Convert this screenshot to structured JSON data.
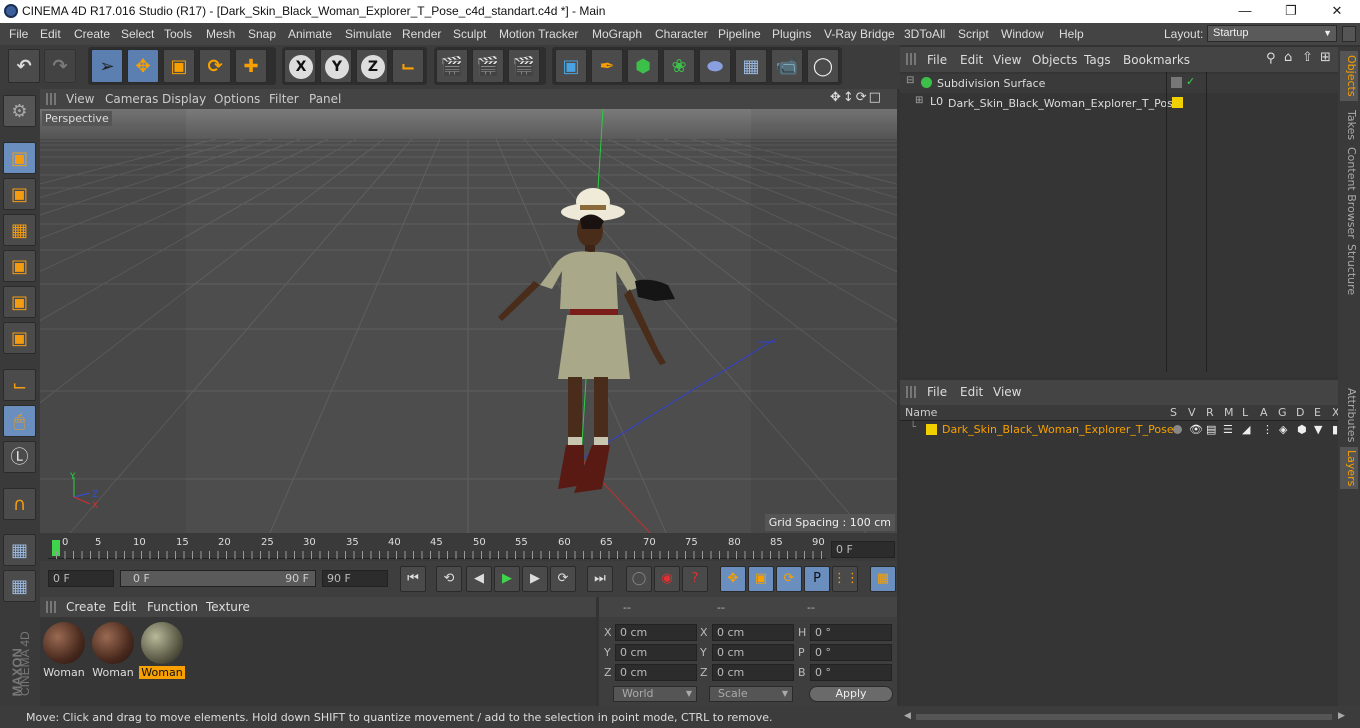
{
  "window": {
    "title": "CINEMA 4D R17.016 Studio (R17) - [Dark_Skin_Black_Woman_Explorer_T_Pose_c4d_standart.c4d *] - Main"
  },
  "menubar": {
    "items": [
      "File",
      "Edit",
      "Create",
      "Select",
      "Tools",
      "Mesh",
      "Snap",
      "Animate",
      "Simulate",
      "Render",
      "Sculpt",
      "Motion Tracker",
      "MoGraph",
      "Character",
      "Pipeline",
      "Plugins",
      "V-Ray Bridge",
      "3DToAll",
      "Script",
      "Window",
      "Help"
    ],
    "layout_label": "Layout:",
    "layout_value": "Startup"
  },
  "viewport": {
    "menu": [
      "View",
      "Cameras",
      "Display",
      "Options",
      "Filter",
      "Panel"
    ],
    "label": "Perspective",
    "grid_spacing": "Grid Spacing : 100 cm"
  },
  "timeline": {
    "ticks": [
      "0",
      "5",
      "10",
      "15",
      "20",
      "25",
      "30",
      "35",
      "40",
      "45",
      "50",
      "55",
      "60",
      "65",
      "70",
      "75",
      "80",
      "85",
      "90"
    ],
    "end_field": "0 F"
  },
  "transport": {
    "start_frame": "0 F",
    "range_start": "0 F",
    "range_end": "90 F",
    "max_frame": "90 F"
  },
  "materials": {
    "menu": [
      "Create",
      "Edit",
      "Function",
      "Texture"
    ],
    "items": [
      {
        "name": "Woman"
      },
      {
        "name": "Woman"
      },
      {
        "name": "Woman",
        "selected": true
      }
    ]
  },
  "coords": {
    "headers": [
      "--",
      "--",
      "--"
    ],
    "rows": [
      {
        "a": "X",
        "av": "0 cm",
        "b": "X",
        "bv": "0 cm",
        "c": "H",
        "cv": "0 °"
      },
      {
        "a": "Y",
        "av": "0 cm",
        "b": "Y",
        "bv": "0 cm",
        "c": "P",
        "cv": "0 °"
      },
      {
        "a": "Z",
        "av": "0 cm",
        "b": "Z",
        "bv": "0 cm",
        "c": "B",
        "cv": "0 °"
      }
    ],
    "space": "World",
    "mode": "Scale",
    "apply": "Apply"
  },
  "objects": {
    "menu": [
      "File",
      "Edit",
      "View",
      "Objects",
      "Tags",
      "Bookmarks"
    ],
    "items": [
      {
        "name": "Subdivision Surface"
      },
      {
        "name": "Dark_Skin_Black_Woman_Explorer_T_Pose"
      }
    ]
  },
  "layers": {
    "menu": [
      "File",
      "Edit",
      "View"
    ],
    "columns": [
      "Name",
      "S",
      "V",
      "R",
      "M",
      "L",
      "A",
      "G",
      "D",
      "E",
      "X"
    ],
    "rows": [
      {
        "name": "Dark_Skin_Black_Woman_Explorer_T_Pose"
      }
    ]
  },
  "side_tabs": [
    "Objects",
    "Takes",
    "Content Browser",
    "Structure",
    "Attributes",
    "Layers"
  ],
  "status": "Move: Click and drag to move elements. Hold down SHIFT to quantize movement / add to the selection in point mode, CTRL to remove.",
  "brand": {
    "line1": "MAXON",
    "line2": "CINEMA 4D"
  },
  "colors": {
    "accent": "#f7a000",
    "selection": "#5a7fb0",
    "layer": "#f0d000"
  }
}
